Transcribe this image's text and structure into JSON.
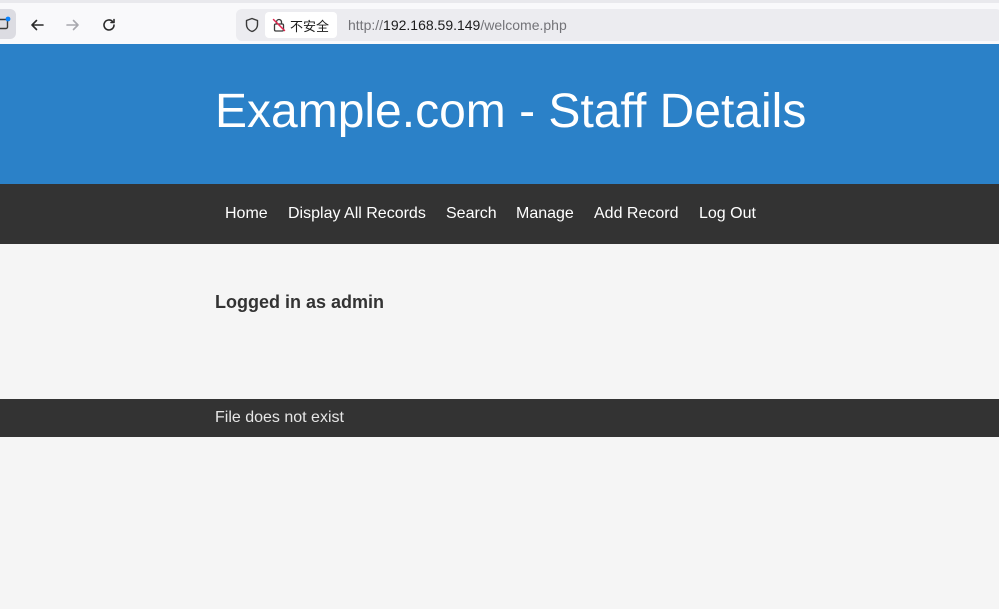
{
  "browser": {
    "security_label": "不安全",
    "url_scheme": "http://",
    "url_host": "192.168.59.149",
    "url_path": "/welcome.php"
  },
  "page": {
    "site_title": "Example.com - Staff Details",
    "nav": [
      {
        "label": "Home"
      },
      {
        "label": "Display All Records"
      },
      {
        "label": "Search"
      },
      {
        "label": "Manage"
      },
      {
        "label": "Add Record"
      },
      {
        "label": "Log Out"
      }
    ],
    "status_heading": "Logged in as admin",
    "footer_message": "File does not exist"
  },
  "colors": {
    "header_blue": "#2b81c8",
    "nav_dark": "#333333",
    "page_bg": "#f5f5f5"
  }
}
